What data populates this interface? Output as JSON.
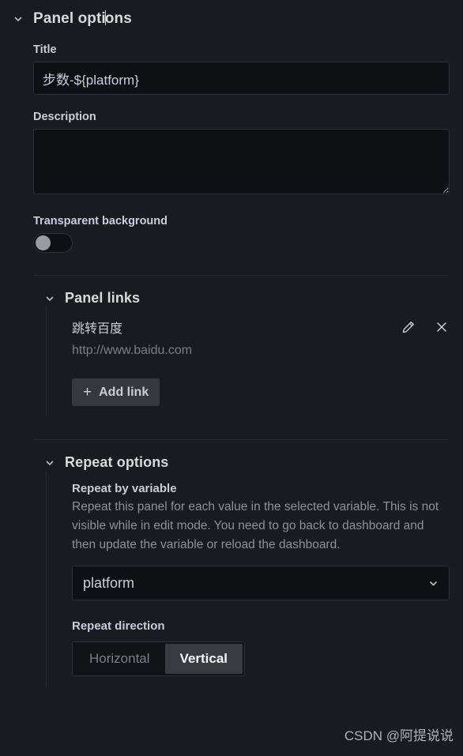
{
  "panel_options": {
    "header_title_before_caret": "Panel opti",
    "header_title_after_caret": "ons",
    "chevron_icon": "chevron-down-icon",
    "title": {
      "label": "Title",
      "value": "步数-${platform}"
    },
    "description": {
      "label": "Description",
      "value": "",
      "placeholder": ""
    },
    "transparent_background": {
      "label": "Transparent background",
      "enabled": false
    }
  },
  "panel_links": {
    "header": "Panel links",
    "chevron_icon": "chevron-down-icon",
    "links": [
      {
        "title": "跳转百度",
        "url": "http://www.baidu.com",
        "edit_icon": "pencil-icon",
        "remove_icon": "close-icon"
      }
    ],
    "add_link_button": {
      "label": "Add link",
      "icon": "plus-icon"
    }
  },
  "repeat_options": {
    "header": "Repeat options",
    "chevron_icon": "chevron-down-icon",
    "repeat_by_variable": {
      "label": "Repeat by variable",
      "help": "Repeat this panel for each value in the selected variable. This is not visible while in edit mode. You need to go back to dashboard and then update the variable or reload the dashboard.",
      "selected": "platform",
      "chevron_icon": "chevron-down-icon"
    },
    "repeat_direction": {
      "label": "Repeat direction",
      "options": [
        {
          "label": "Horizontal",
          "selected": false
        },
        {
          "label": "Vertical",
          "selected": true
        }
      ]
    }
  },
  "watermark": "CSDN @阿提说说",
  "colors": {
    "background": "#181b1f",
    "input_background": "#0e1013",
    "border": "#2c3235",
    "text_primary": "#ccccdc",
    "text_muted": "#8e9199",
    "selected_segment": "#383b40"
  }
}
